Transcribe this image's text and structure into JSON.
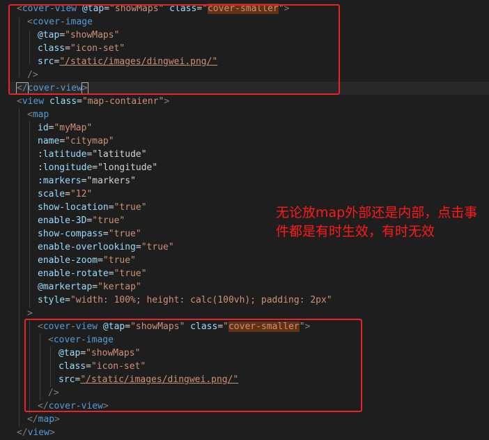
{
  "colors": {
    "background": "#1e1e1e",
    "tag": "#569cd6",
    "attribute": "#9cdcfe",
    "string": "#ce9178",
    "punctuation": "#808080",
    "annotation": "#ff1a1a",
    "highlight_box": "#e5242b"
  },
  "code": {
    "l1": {
      "open": "<",
      "tag": "cover-view",
      "a1": " @tap",
      "eq1": "=",
      "v1": "\"showMaps\"",
      "a2": " class",
      "eq2": "=",
      "q_open": "\"",
      "v2": "cover-smaller",
      "q_close": "\"",
      "close": ">"
    },
    "l2": {
      "open": "<",
      "tag": "cover-image"
    },
    "l3": {
      "attr": "@tap",
      "eq": "=",
      "val": "\"showMaps\""
    },
    "l4": {
      "attr": "class",
      "eq": "=",
      "val": "\"icon-set\""
    },
    "l5": {
      "attr": "src",
      "eq": "=",
      "val": "\"/static/images/dingwei.png/\""
    },
    "l6": {
      "close": "/>"
    },
    "l7": {
      "open": "</",
      "tag": "cover-view",
      "close": ">"
    },
    "l8": {
      "open": "<",
      "tag": "view",
      "attr": " class",
      "eq": "=",
      "val": "\"map-contaienr\"",
      "close": ">"
    },
    "l9": {
      "open": "<",
      "tag": "map"
    },
    "l10": {
      "attr": "id",
      "eq": "=",
      "val": "\"myMap\""
    },
    "l11": {
      "attr": "name",
      "eq": "=",
      "val": "\"citymap\""
    },
    "l12": {
      "attr": ":latitude",
      "eq": "=",
      "val": "\"latitude\""
    },
    "l13": {
      "attr": ":longitude",
      "eq": "=",
      "val": "\"longitude\""
    },
    "l14": {
      "attr": ":markers",
      "eq": "=",
      "val": "\"markers\""
    },
    "l15": {
      "attr": "scale",
      "eq": "=",
      "val": "\"12\""
    },
    "l16": {
      "attr": "show-location",
      "eq": "=",
      "val": "\"true\""
    },
    "l17": {
      "attr": "enable-3D",
      "eq": "=",
      "val": "\"true\""
    },
    "l18": {
      "attr": "show-compass",
      "eq": "=",
      "val": "\"true\""
    },
    "l19": {
      "attr": "enable-overlooking",
      "eq": "=",
      "val": "\"true\""
    },
    "l20": {
      "attr": "enable-zoom",
      "eq": "=",
      "val": "\"true\""
    },
    "l21": {
      "attr": "enable-rotate",
      "eq": "=",
      "val": "\"true\""
    },
    "l22": {
      "attr": "@markertap",
      "eq": "=",
      "val": "\"kertap\""
    },
    "l23": {
      "attr": "style",
      "eq": "=",
      "val": "\"width: 100%; height: calc(100vh); padding: 2px\""
    },
    "l24": {
      "close": ">"
    },
    "l25": {
      "open": "<",
      "tag": "cover-view",
      "a1": " @tap",
      "eq1": "=",
      "v1": "\"showMaps\"",
      "a2": " class",
      "eq2": "=",
      "q_open": "\"",
      "v2": "cover-smaller",
      "q_close": "\"",
      "close": ">"
    },
    "l26": {
      "open": "<",
      "tag": "cover-image"
    },
    "l27": {
      "attr": "@tap",
      "eq": "=",
      "val": "\"showMaps\""
    },
    "l28": {
      "attr": "class",
      "eq": "=",
      "val": "\"icon-set\""
    },
    "l29": {
      "attr": "src",
      "eq": "=",
      "val": "\"/static/images/dingwei.png/\""
    },
    "l30": {
      "close": "/>"
    },
    "l31": {
      "open": "</",
      "tag": "cover-view",
      "close": ">"
    },
    "l32": {
      "open": "</",
      "tag": "map",
      "close": ">"
    },
    "l33": {
      "open": "</",
      "tag": "view",
      "close": ">"
    }
  },
  "annotation": {
    "text": "无论放map外部还是内部，点击事件都是有时生效，有时无效"
  }
}
